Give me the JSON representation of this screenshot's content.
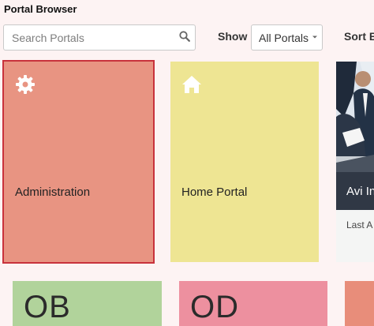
{
  "header": {
    "title": "Portal Browser"
  },
  "toolbar": {
    "search_placeholder": "Search Portals",
    "search_icon": "search-icon",
    "show_label": "Show",
    "show_value": "All Portals",
    "sort_label": "Sort B"
  },
  "tiles": [
    {
      "label": "Administration",
      "icon": "gear-icon",
      "color": "#e89482",
      "selected": true
    },
    {
      "label": "Home Portal",
      "icon": "home-icon",
      "color": "#eee593"
    },
    {
      "label": "Avi In",
      "meta": "Last A",
      "image": "business-people-photo"
    },
    {
      "abbr": "OB",
      "color": "#b1d39b"
    },
    {
      "abbr": "OD",
      "color": "#ed909f"
    },
    {
      "abbr": "",
      "color": "#e88d7a"
    }
  ],
  "colors": {
    "selection_border": "#c8323c",
    "background": "#fdf3f3"
  }
}
